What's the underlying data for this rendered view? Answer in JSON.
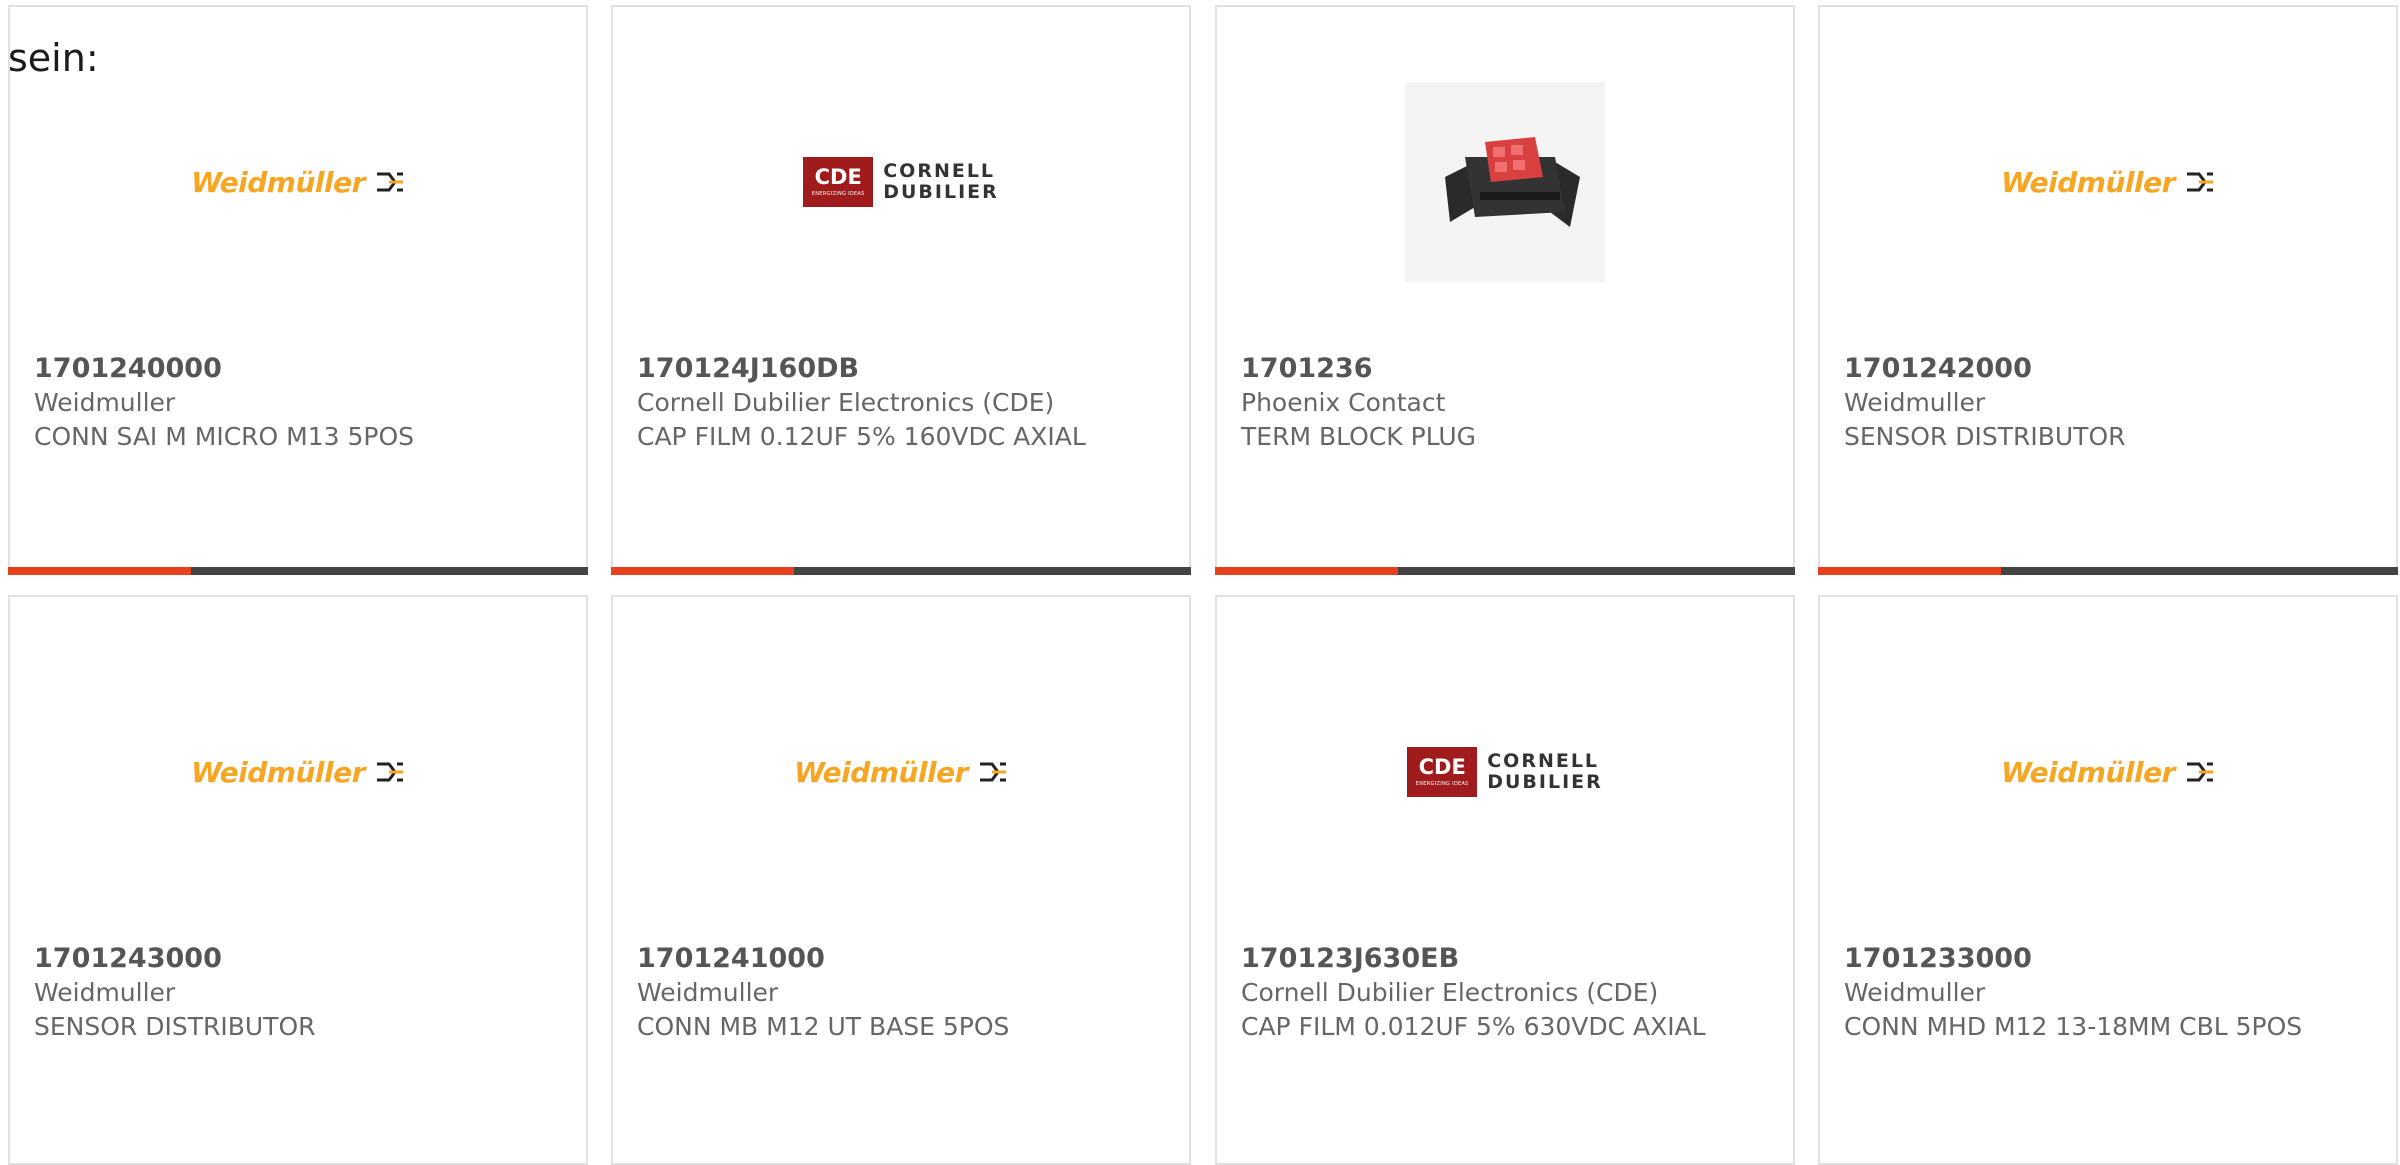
{
  "intro_text": "sein:",
  "accent_color": "#e8401c",
  "bar_color": "#444444",
  "cards": [
    {
      "part_number": "1701240000",
      "manufacturer": "Weidmuller",
      "description": "CONN SAI M MICRO M13 5POS",
      "image": "weidmuller-logo",
      "logo_text": "Weidmüller"
    },
    {
      "part_number": "170124J160DB",
      "manufacturer": "Cornell Dubilier Electronics (CDE)",
      "description": "CAP FILM 0.12UF 5% 160VDC AXIAL",
      "image": "cde-logo",
      "logo_box_text": "CDE",
      "logo_tagline": "ENERGIZING IDEAS",
      "logo_line1": "CORNELL",
      "logo_line2": "DUBILIER"
    },
    {
      "part_number": "1701236",
      "manufacturer": "Phoenix Contact",
      "description": "TERM BLOCK PLUG",
      "image": "product-photo"
    },
    {
      "part_number": "1701242000",
      "manufacturer": "Weidmuller",
      "description": "SENSOR DISTRIBUTOR",
      "image": "weidmuller-logo",
      "logo_text": "Weidmüller"
    },
    {
      "part_number": "1701243000",
      "manufacturer": "Weidmuller",
      "description": "SENSOR DISTRIBUTOR",
      "image": "weidmuller-logo",
      "logo_text": "Weidmüller"
    },
    {
      "part_number": "1701241000",
      "manufacturer": "Weidmuller",
      "description": "CONN MB M12 UT BASE 5POS",
      "image": "weidmuller-logo",
      "logo_text": "Weidmüller"
    },
    {
      "part_number": "170123J630EB",
      "manufacturer": "Cornell Dubilier Electronics (CDE)",
      "description": "CAP FILM 0.012UF 5% 630VDC AXIAL",
      "image": "cde-logo",
      "logo_box_text": "CDE",
      "logo_tagline": "ENERGIZING IDEAS",
      "logo_line1": "CORNELL",
      "logo_line2": "DUBILIER"
    },
    {
      "part_number": "1701233000",
      "manufacturer": "Weidmuller",
      "description": "CONN MHD M12 13-18MM CBL 5POS",
      "image": "weidmuller-logo",
      "logo_text": "Weidmüller"
    }
  ]
}
